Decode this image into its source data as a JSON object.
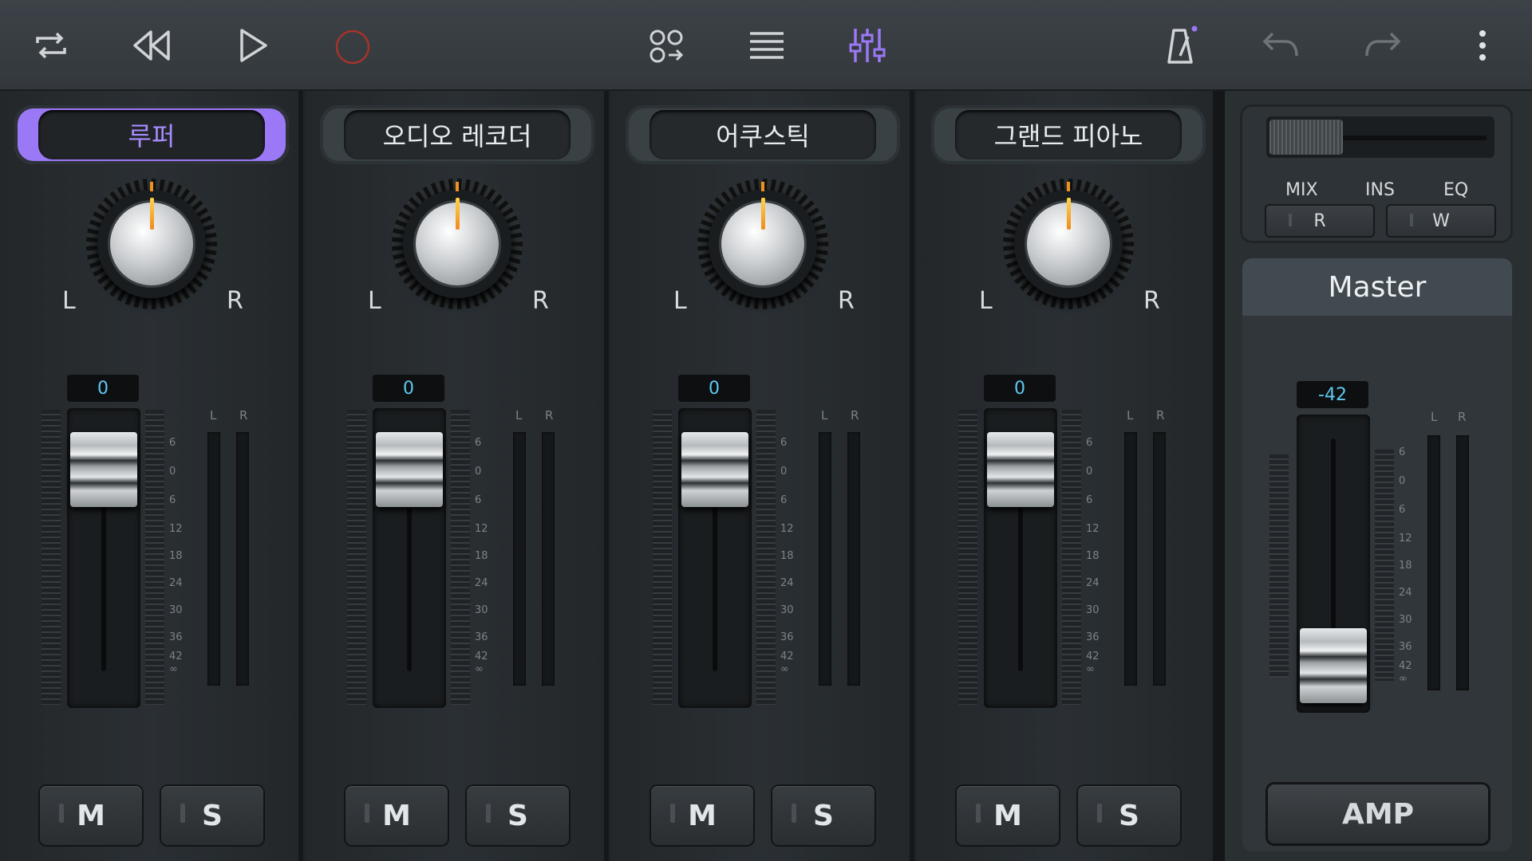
{
  "toolbar": {
    "icons": [
      "loop-icon",
      "rewind-icon",
      "play-icon",
      "record-icon",
      "tracks-icon",
      "list-icon",
      "mixer-icon",
      "metronome-icon",
      "undo-icon",
      "redo-icon",
      "more-icon"
    ],
    "accent": "#9b78f5",
    "record_color": "#c0392b"
  },
  "channels": [
    {
      "name": "루퍼",
      "selected": true,
      "volume": "0",
      "pan_left": "L",
      "pan_right": "R",
      "mute": "M",
      "solo": "S",
      "meter_left": "L",
      "meter_right": "R"
    },
    {
      "name": "오디오 레코더",
      "selected": false,
      "volume": "0",
      "pan_left": "L",
      "pan_right": "R",
      "mute": "M",
      "solo": "S",
      "meter_left": "L",
      "meter_right": "R"
    },
    {
      "name": "어쿠스틱",
      "selected": false,
      "volume": "0",
      "pan_left": "L",
      "pan_right": "R",
      "mute": "M",
      "solo": "S",
      "meter_left": "L",
      "meter_right": "R"
    },
    {
      "name": "그랜드 피아노",
      "selected": false,
      "volume": "0",
      "pan_left": "L",
      "pan_right": "R",
      "mute": "M",
      "solo": "S",
      "meter_left": "L",
      "meter_right": "R"
    }
  ],
  "scale_labels": [
    "6",
    "0",
    "6",
    "12",
    "18",
    "24",
    "30",
    "36",
    "42",
    "∞"
  ],
  "right_panel": {
    "tabs": [
      "MIX",
      "INS",
      "EQ"
    ],
    "read_button": "R",
    "write_button": "W"
  },
  "master": {
    "title": "Master",
    "volume": "-42",
    "meter_left": "L",
    "meter_right": "R",
    "amp_button": "AMP"
  }
}
